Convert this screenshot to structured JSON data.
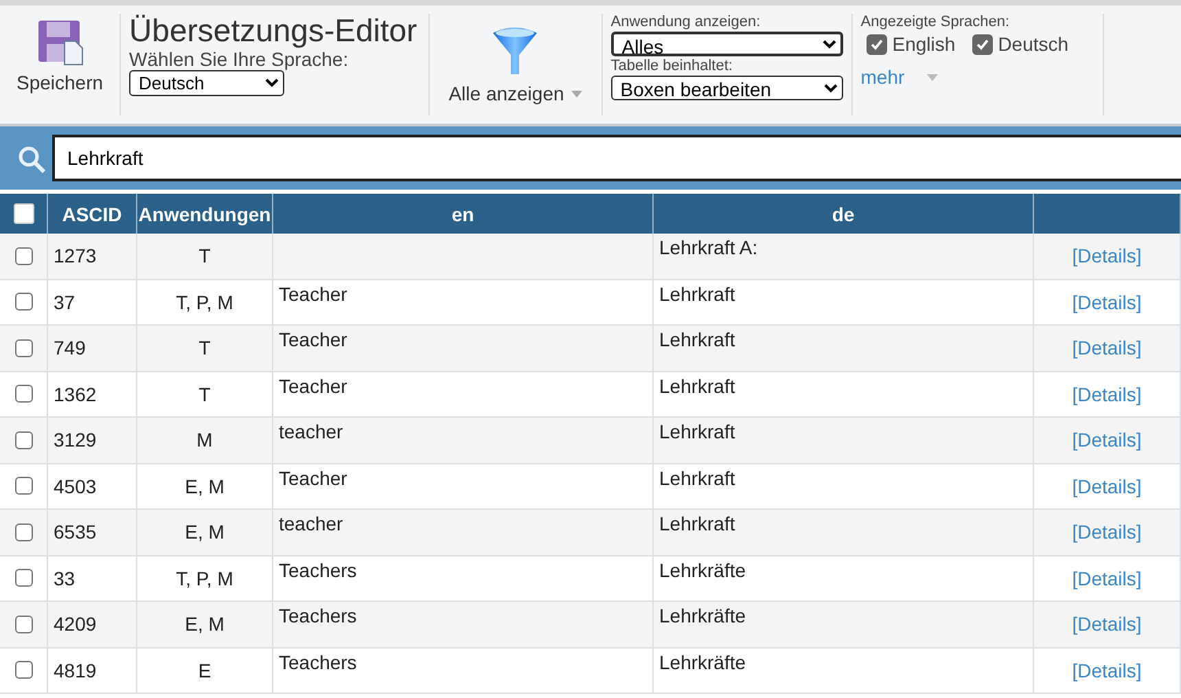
{
  "toolbar": {
    "save_label": "Speichern",
    "title": "Übersetzungs-Editor",
    "language_label": "Wählen Sie Ihre Sprache:",
    "language_value": "Deutsch",
    "filter_label": "Alle anzeigen",
    "app_label": "Anwendung anzeigen:",
    "app_value": "Alles",
    "table_label": "Tabelle beinhaltet:",
    "table_value": "Boxen bearbeiten",
    "languages_label": "Angezeigte Sprachen:",
    "languages": [
      {
        "label": "English",
        "checked": true
      },
      {
        "label": "Deutsch",
        "checked": true
      }
    ],
    "more_label": "mehr"
  },
  "search": {
    "value": "Lehrkraft"
  },
  "table": {
    "select_all": {
      "checked": false
    },
    "columns": [
      "ASCID",
      "Anwendungen",
      "en",
      "de"
    ],
    "rows": [
      {
        "checked": false,
        "ascid": "1273",
        "apps": "T",
        "de": "Lehrkraft A:",
        "details": "[Details]"
      },
      {
        "checked": false,
        "ascid": "37",
        "apps": "T, P, M",
        "en": "Teacher",
        "de": "Lehrkraft",
        "details": "[Details]"
      },
      {
        "checked": false,
        "ascid": "749",
        "apps": "T",
        "en": "Teacher",
        "de": "Lehrkraft",
        "details": "[Details]"
      },
      {
        "checked": false,
        "ascid": "1362",
        "apps": "T",
        "en": "Teacher",
        "de": "Lehrkraft",
        "details": "[Details]"
      },
      {
        "checked": false,
        "ascid": "3129",
        "apps": "M",
        "en": "teacher",
        "de": "Lehrkraft",
        "details": "[Details]"
      },
      {
        "checked": false,
        "ascid": "4503",
        "apps": "E, M",
        "en": "Teacher",
        "de": "Lehrkraft",
        "details": "[Details]"
      },
      {
        "checked": false,
        "ascid": "6535",
        "apps": "E, M",
        "en": "teacher",
        "de": "Lehrkraft",
        "details": "[Details]"
      },
      {
        "checked": false,
        "ascid": "33",
        "apps": "T, P, M",
        "en": "Teachers",
        "de": "Lehrkräfte",
        "details": "[Details]"
      },
      {
        "checked": false,
        "ascid": "4209",
        "apps": "E, M",
        "en": "Teachers",
        "de": "Lehrkräfte",
        "details": "[Details]"
      },
      {
        "checked": false,
        "ascid": "4819",
        "apps": "E",
        "en": "Teachers",
        "de": "Lehrkräfte",
        "details": "[Details]"
      }
    ]
  }
}
